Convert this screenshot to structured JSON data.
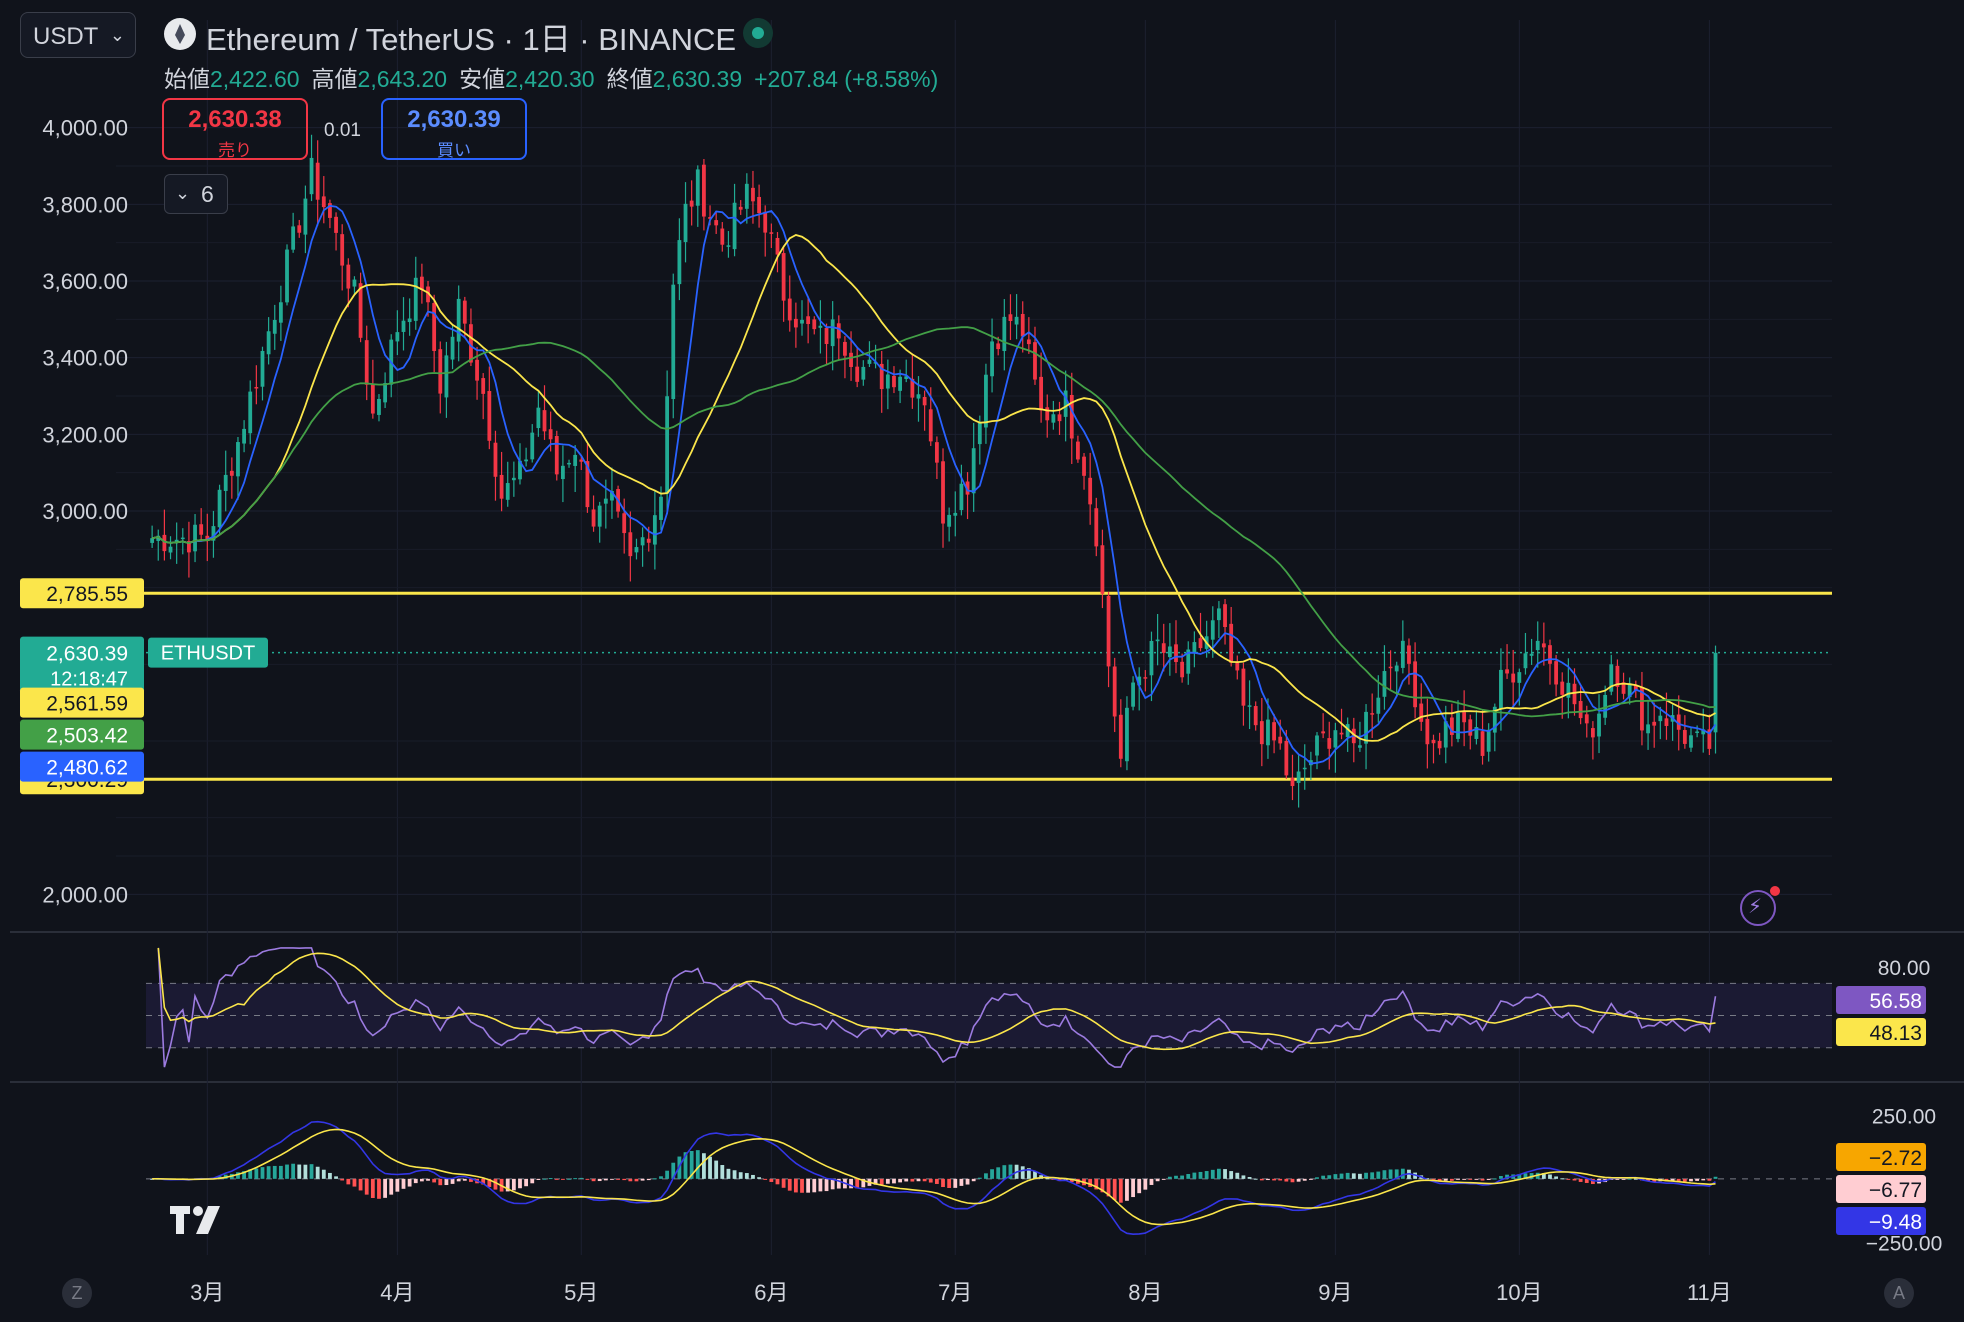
{
  "toolbar": {
    "currency_select": "USDT",
    "currency_chevron": "⌄"
  },
  "header": {
    "title": "Ethereum / TetherUS · 1日 · BINANCE",
    "ohlc": {
      "open_label": "始値",
      "open": "2,422.60",
      "high_label": "高値",
      "high": "2,643.20",
      "low_label": "安値",
      "low": "2,420.30",
      "close_label": "終値",
      "close": "2,630.39",
      "change": "+207.84 (+8.58%)"
    }
  },
  "trade": {
    "sell_price": "2,630.38",
    "sell_label": "売り",
    "spread": "0.01",
    "buy_price": "2,630.39",
    "buy_label": "買い"
  },
  "indicators_toggle": {
    "count": "6",
    "chevron": "⌄"
  },
  "colors": {
    "background": "#10131b",
    "up": "#22ab94",
    "down": "#f23645",
    "ma_fast": "#2962ff",
    "ma_mid": "#fbe64b",
    "ma_slow": "#43a047",
    "level": "#fbe64b",
    "rsi": "#9c7be0",
    "macd_line": "#3336e6",
    "signal": "#fbe64b"
  },
  "chart_data": [
    {
      "type": "candlestick",
      "symbol_label": "ETHUSDT",
      "y_ticks": [
        "4,000.00",
        "3,800.00",
        "3,600.00",
        "3,400.00",
        "3,200.00",
        "3,000.00",
        "2,000.00"
      ],
      "y_tick_values": [
        4000,
        3800,
        3600,
        3400,
        3200,
        3000,
        2000
      ],
      "ylim": [
        1920,
        4020
      ],
      "x_labels": [
        "3月",
        "4月",
        "5月",
        "6月",
        "7月",
        "8月",
        "9月",
        "10月",
        "11月"
      ],
      "x_label_days": [
        0,
        31,
        61,
        92,
        122,
        153,
        184,
        214,
        245
      ],
      "day_range": [
        -10,
        265
      ],
      "first_day_offset": -9,
      "horizontal_levels": [
        {
          "value": 2785.55,
          "label": "2,785.55"
        },
        {
          "value": 2300.29,
          "label": "2,300.29"
        }
      ],
      "price_labels": [
        {
          "value": 2630.39,
          "text": "2,630.39",
          "sub": "12:18:47",
          "color": "#22ab94"
        },
        {
          "value": 2561.59,
          "text": "2,561.59",
          "color": "#fbe64b"
        },
        {
          "value": 2503.42,
          "text": "2,503.42",
          "color": "#43a047"
        },
        {
          "value": 2480.62,
          "text": "2,480.62",
          "color": "#2962ff"
        }
      ],
      "close_anchors": [
        [
          0,
          2930
        ],
        [
          5,
          3180
        ],
        [
          10,
          3470
        ],
        [
          14,
          3700
        ],
        [
          17,
          3880
        ],
        [
          20,
          3760
        ],
        [
          24,
          3560
        ],
        [
          27,
          3250
        ],
        [
          31,
          3480
        ],
        [
          35,
          3600
        ],
        [
          38,
          3330
        ],
        [
          41,
          3530
        ],
        [
          45,
          3310
        ],
        [
          48,
          3040
        ],
        [
          51,
          3090
        ],
        [
          54,
          3270
        ],
        [
          57,
          3100
        ],
        [
          60,
          3170
        ],
        [
          63,
          2980
        ],
        [
          66,
          3010
        ],
        [
          69,
          2860
        ],
        [
          72,
          2960
        ],
        [
          74,
          3050
        ],
        [
          76,
          3600
        ],
        [
          78,
          3780
        ],
        [
          80,
          3850
        ],
        [
          84,
          3700
        ],
        [
          88,
          3820
        ],
        [
          91,
          3760
        ],
        [
          94,
          3570
        ],
        [
          97,
          3480
        ],
        [
          100,
          3450
        ],
        [
          103,
          3480
        ],
        [
          106,
          3380
        ],
        [
          110,
          3350
        ],
        [
          113,
          3370
        ],
        [
          117,
          3300
        ],
        [
          120,
          3000
        ],
        [
          124,
          3080
        ],
        [
          128,
          3450
        ],
        [
          131,
          3500
        ],
        [
          133,
          3470
        ],
        [
          136,
          3250
        ],
        [
          140,
          3280
        ],
        [
          143,
          3120
        ],
        [
          145,
          2950
        ],
        [
          147,
          2600
        ],
        [
          149,
          2350
        ],
        [
          151,
          2550
        ],
        [
          155,
          2650
        ],
        [
          159,
          2570
        ],
        [
          162,
          2650
        ],
        [
          165,
          2720
        ],
        [
          167,
          2600
        ],
        [
          169,
          2480
        ],
        [
          172,
          2430
        ],
        [
          175,
          2380
        ],
        [
          177,
          2260
        ],
        [
          179,
          2330
        ],
        [
          181,
          2380
        ],
        [
          184,
          2440
        ],
        [
          187,
          2380
        ],
        [
          190,
          2500
        ],
        [
          192,
          2580
        ],
        [
          194,
          2640
        ],
        [
          196,
          2600
        ],
        [
          198,
          2460
        ],
        [
          200,
          2380
        ],
        [
          202,
          2430
        ],
        [
          205,
          2440
        ],
        [
          208,
          2390
        ],
        [
          211,
          2550
        ],
        [
          214,
          2610
        ],
        [
          217,
          2670
        ],
        [
          220,
          2590
        ],
        [
          223,
          2500
        ],
        [
          225,
          2410
        ],
        [
          227,
          2480
        ],
        [
          229,
          2610
        ],
        [
          232,
          2530
        ],
        [
          235,
          2440
        ],
        [
          237,
          2480
        ],
        [
          240,
          2430
        ],
        [
          243,
          2390
        ],
        [
          245,
          2390
        ],
        [
          246,
          2630
        ]
      ],
      "moving_averages": [
        {
          "name": "MA fast",
          "color": "#2962ff",
          "last": 2480.62
        },
        {
          "name": "MA mid",
          "color": "#fbe64b",
          "last": 2561.59
        },
        {
          "name": "MA slow",
          "color": "#43a047",
          "last": 2503.42
        }
      ]
    },
    {
      "type": "line",
      "name_hint": "RSI",
      "y_ticks": [
        "80.00"
      ],
      "ylim": [
        10,
        100
      ],
      "band": [
        30,
        70
      ],
      "mid": 50,
      "last_values": [
        {
          "text": "56.58",
          "color": "#7e57c2"
        },
        {
          "text": "48.13",
          "color": "#fbe64b"
        }
      ]
    },
    {
      "type": "line+bar",
      "name_hint": "MACD",
      "y_ticks": [
        "250.00",
        "−250.00"
      ],
      "ylim": [
        -300,
        350
      ],
      "last_values": [
        {
          "text": "−2.72",
          "color": "#f7a600"
        },
        {
          "text": "−6.77",
          "color": "#ffcdd2"
        },
        {
          "text": "−9.48",
          "color": "#3336e6"
        }
      ]
    }
  ]
}
